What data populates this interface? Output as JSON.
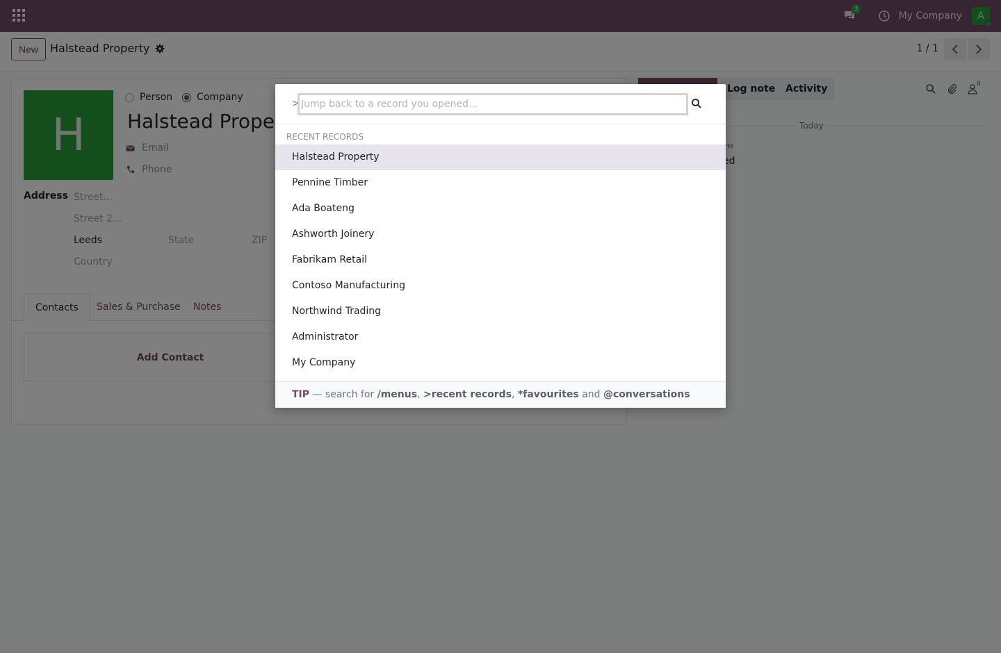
{
  "navbar": {
    "chat_count": "3",
    "company": "My Company",
    "user_initial": "A"
  },
  "control": {
    "new_label": "New",
    "record_title": "Halstead Property",
    "pager": "1 / 1"
  },
  "form": {
    "type_person": "Person",
    "type_company": "Company",
    "company_selected": true,
    "avatar_letter": "H",
    "name": "Halstead Property",
    "email_placeholder": "Email",
    "phone_placeholder": "Phone",
    "address_label": "Address",
    "street_placeholder": "Street...",
    "street2_placeholder": "Street 2...",
    "city": "Leeds",
    "state_placeholder": "State",
    "zip_placeholder": "ZIP",
    "country_placeholder": "Country",
    "tabs": [
      "Contacts",
      "Sales & Purchase",
      "Notes"
    ],
    "active_tab": "Contacts",
    "add_contact": "Add Contact"
  },
  "chatter": {
    "log_note": "Log note",
    "activity": "Activity",
    "followers_count": "0",
    "today": "Today",
    "message_time": "PM",
    "message_text": "ed"
  },
  "command_palette": {
    "prefix": ">",
    "placeholder": "Jump back to a record you opened...",
    "section_title": "RECENT RECORDS",
    "records": [
      "Halstead Property",
      "Pennine Timber",
      "Ada Boateng",
      "Ashworth Joinery",
      "Fabrikam Retail",
      "Contoso Manufacturing",
      "Northwind Trading",
      "Administrator",
      "My Company"
    ],
    "selected_index": 0,
    "footer": {
      "tip": "TIP",
      "text1": " — search for ",
      "menus": "/menus",
      "sep1": ", ",
      "recent": ">recent records",
      "sep2": ", ",
      "favourites": "*favourites",
      "and": " and ",
      "conversations": "@conversations"
    }
  },
  "colors": {
    "brand": "#714b67",
    "avatar_green": "#2a9d3b"
  }
}
